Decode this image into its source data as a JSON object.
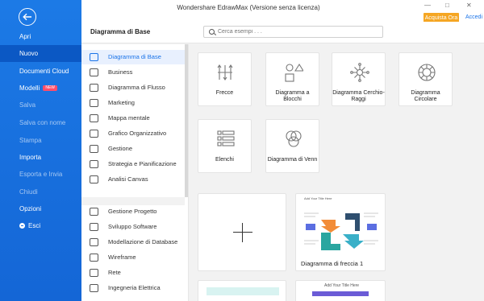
{
  "app": {
    "title": "Wondershare EdrawMax (Versione senza licenza)",
    "buy_label": "Acquista Ora",
    "login_label": "Accedi"
  },
  "nav": {
    "items": [
      {
        "label": "Apri"
      },
      {
        "label": "Nuovo"
      },
      {
        "label": "Documenti Cloud"
      },
      {
        "label": "Modelli",
        "badge": "NEW"
      },
      {
        "label": "Salva"
      },
      {
        "label": "Salva con nome"
      },
      {
        "label": "Stampa"
      },
      {
        "label": "Importa"
      },
      {
        "label": "Esporta e Invia"
      },
      {
        "label": "Chiudi"
      },
      {
        "label": "Opzioni"
      },
      {
        "label": "Esci"
      }
    ]
  },
  "header": {
    "section_title": "Diagramma di Base",
    "search_placeholder": "Cerca esempi . . ."
  },
  "categories": [
    {
      "label": "Diagramma di Base"
    },
    {
      "label": "Business"
    },
    {
      "label": "Diagramma di Flusso"
    },
    {
      "label": "Marketing"
    },
    {
      "label": "Mappa mentale"
    },
    {
      "label": "Grafico Organizzativo"
    },
    {
      "label": "Gestione"
    },
    {
      "label": "Strategia e Pianificazione"
    },
    {
      "label": "Analisi Canvas"
    },
    {
      "label": "Gestione Progetto"
    },
    {
      "label": "Sviluppo Software"
    },
    {
      "label": "Modellazione di Database"
    },
    {
      "label": "Wireframe"
    },
    {
      "label": "Rete"
    },
    {
      "label": "Ingegneria Elettrica"
    }
  ],
  "types": [
    {
      "label": "Frecce"
    },
    {
      "label": "Diagramma a Blocchi"
    },
    {
      "label": "Diagramma Cerchio-Raggi"
    },
    {
      "label": "Diagramma Circolare"
    },
    {
      "label": "Elenchi"
    },
    {
      "label": "Diagramma di Venn"
    }
  ],
  "templates": {
    "first_title": "Diagramma di freccia 1",
    "preview_heading": "Add Your Title Here",
    "preview_heading_2": "Add Your Title Here"
  },
  "colors": {
    "nav_blue": "#1a73e8",
    "buy_orange": "#f5a623",
    "badge_red": "#ff4d6a"
  }
}
